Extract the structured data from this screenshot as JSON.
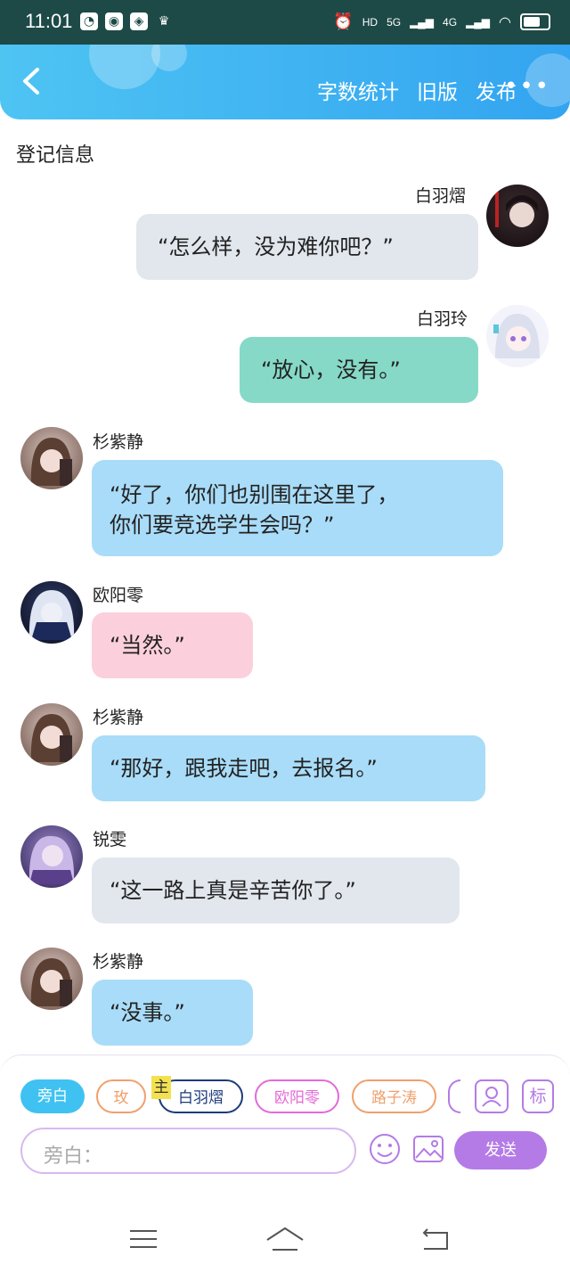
{
  "status": {
    "time": "11:01",
    "network_labels": [
      "HD",
      "5G",
      "4G"
    ]
  },
  "header": {
    "nav": [
      "字数统计",
      "旧版",
      "发布"
    ],
    "more": "•••",
    "section_title": "登记信息"
  },
  "messages": [
    {
      "name": "白羽熠",
      "text": "“怎么样，没为难你吧？”",
      "side": "right",
      "color": "#e2e7ee"
    },
    {
      "name": "白羽玲",
      "text": "“放心，没有。”",
      "side": "right",
      "color": "#86d9c7"
    },
    {
      "name": "杉紫静",
      "text_lines": [
        "“好了，你们也别围在这里了，",
        "你们要竞选学生会吗？”"
      ],
      "side": "left",
      "color": "#a9dcf8"
    },
    {
      "name": "欧阳零",
      "text": "“当然。”",
      "side": "left",
      "color": "#fbd0dc"
    },
    {
      "name": "杉紫静",
      "text": "“那好，跟我走吧，去报名。”",
      "side": "left",
      "color": "#a9dcf8"
    },
    {
      "name": "锐雯",
      "text": "“这一路上真是辛苦你了。”",
      "side": "left",
      "color": "#e2e7ee"
    },
    {
      "name": "杉紫静",
      "text": "“没事。”",
      "side": "left",
      "color": "#a9dcf8"
    }
  ],
  "roles": [
    {
      "label": "旁白",
      "color": "#3fc2f2"
    },
    {
      "label": "玫",
      "color": "#f0a06c"
    },
    {
      "label": "白羽熠",
      "color": "#1d3b7a",
      "tag": "主"
    },
    {
      "label": "欧阳零",
      "color": "#e36ad9"
    },
    {
      "label": "路子涛",
      "color": "#f0a06c"
    }
  ],
  "input": {
    "placeholder": "旁白：",
    "send": "发送",
    "tag_button": "标"
  },
  "colors": {
    "accent": "#3fc2f2",
    "send": "#b47be6",
    "statusbar": "#1d4a47"
  }
}
